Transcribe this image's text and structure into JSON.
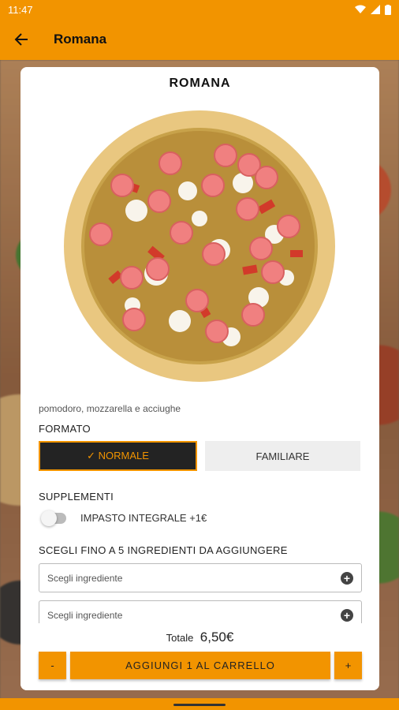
{
  "status_bar": {
    "time": "11:47"
  },
  "app_bar": {
    "title": "Romana"
  },
  "product": {
    "name": "ROMANA",
    "description": "pomodoro, mozzarella e acciughe"
  },
  "format": {
    "label": "FORMATO",
    "options": [
      {
        "label": "✓ NORMALE",
        "selected": true
      },
      {
        "label": "FAMILIARE",
        "selected": false
      }
    ]
  },
  "supplements": {
    "label": "SUPPLEMENTI",
    "items": [
      {
        "label": "IMPASTO INTEGRALE +1€",
        "enabled": false
      }
    ]
  },
  "ingredients": {
    "label": "SCEGLI FINO A 5 INGREDIENTI DA AGGIUNGERE",
    "fields": [
      {
        "placeholder": "Scegli ingrediente"
      },
      {
        "placeholder": "Scegli ingrediente"
      }
    ]
  },
  "total": {
    "label": "Totale",
    "value": "6,50€"
  },
  "actions": {
    "minus": "-",
    "add_label": "AGGIUNGI 1 AL CARRELLO",
    "plus": "+"
  },
  "colors": {
    "accent": "#f29400",
    "dark": "#232323"
  }
}
